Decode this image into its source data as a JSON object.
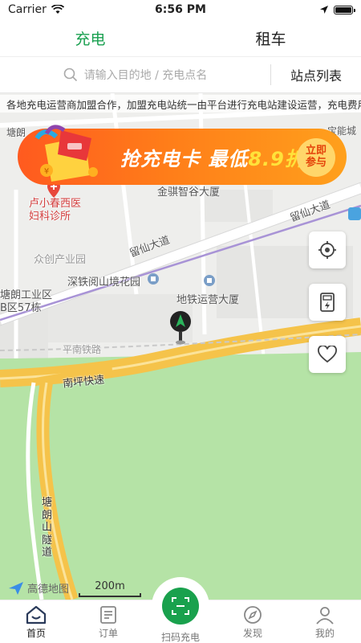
{
  "status_bar": {
    "carrier": "Carrier",
    "time": "6:56 PM"
  },
  "top_tabs": [
    {
      "label": "充电",
      "active": true
    },
    {
      "label": "租车",
      "active": false
    }
  ],
  "search": {
    "placeholder": "请输入目的地 / 充电点名",
    "station_list_label": "站点列表"
  },
  "notice": {
    "text": "各地充电运营商加盟合作，加盟充电站统一由平台进行充电站建设运营，充电费用线上支付"
  },
  "banner": {
    "title": "抢充电卡 最低",
    "price": "8.9折",
    "button": "立即参与"
  },
  "map": {
    "labels": {
      "tanglang_top": "塘朗",
      "baoneng": "宝能城",
      "jinqi": "金骐智谷大厦",
      "luxiaochun": "卢小春西医\n妇科诊所",
      "liuxian_right": "留仙大道",
      "liuxian_mid": "留仙大道",
      "zhongchuang": "众创产业园",
      "shenkuai": "深铁阅山境花园",
      "tanglang_industrial": "塘朗工业区\nB区57栋",
      "ditie": "地铁运营大厦",
      "pingnan": "平南铁路",
      "nanping": "南坪快速",
      "tunnel": "塘\n朗\n山\n隧\n道"
    },
    "logo": "高德地图",
    "scale": "200m"
  },
  "colors": {
    "brand_green": "#1aa050",
    "banner_orange": "#ff7d19",
    "park_green": "#b5e3a6",
    "expressway": "#f5c34a"
  },
  "bottom_nav": [
    {
      "label": "首页",
      "icon": "home-icon",
      "active": true
    },
    {
      "label": "订单",
      "icon": "order-icon",
      "active": false
    },
    {
      "label": "扫码充电",
      "icon": "scan-icon",
      "active": false
    },
    {
      "label": "发现",
      "icon": "compass-icon",
      "active": false
    },
    {
      "label": "我的",
      "icon": "profile-icon",
      "active": false
    }
  ]
}
